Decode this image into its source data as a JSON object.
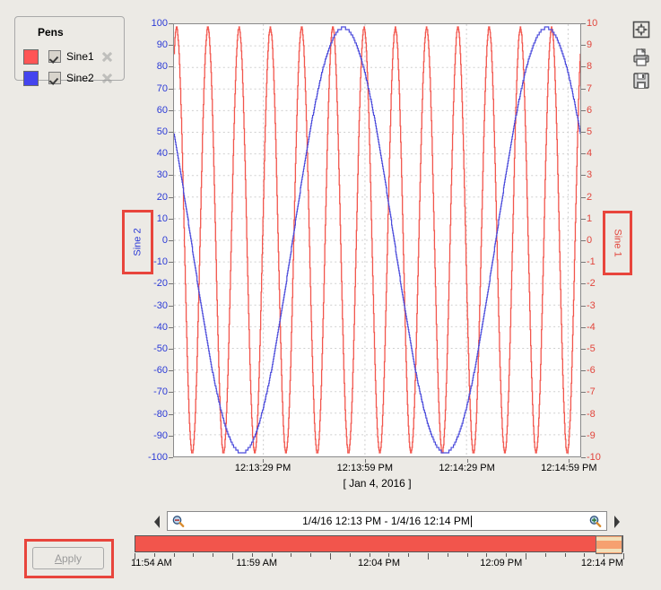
{
  "pens": {
    "title": "Pens",
    "items": [
      {
        "label": "Sine1",
        "color": "#FF5555",
        "checked": true,
        "remove_icon": "close-x-icon"
      },
      {
        "label": "Sine2",
        "color": "#4444EE",
        "checked": true,
        "remove_icon": "close-x-icon"
      }
    ]
  },
  "toolbar": {
    "fit_icon": "fit-to-window-icon",
    "print_icon": "printer-icon",
    "save_icon": "floppy-save-icon"
  },
  "axis_titles": {
    "left": "Sine 2",
    "right": "Sine 1",
    "highlight_color": "#E8453C"
  },
  "range_bar": {
    "left_arrow": "◀",
    "right_arrow": "▶",
    "value": "1/4/16 12:13 PM - 1/4/16 12:14 PM",
    "zoom_out_icon": "magnifier-minus-icon",
    "zoom_in_icon": "magnifier-plus-icon"
  },
  "timeline": {
    "labels": [
      "11:54 AM",
      "11:59 AM",
      "12:04 PM",
      "12:09 PM",
      "12:14 PM"
    ],
    "label_positions": [
      0,
      25,
      50,
      75,
      100
    ],
    "fill_color": "#F2554C",
    "handle_color": "#F6A070",
    "selection_start_pct": 94.5,
    "selection_end_pct": 100,
    "tick_count": 26
  },
  "apply": {
    "label_pre": "",
    "label_mnemonic": "A",
    "label_post": "pply",
    "enabled": false
  },
  "chart_data": {
    "type": "line",
    "title": "",
    "xlabel": "[ Jan 4, 2016 ]",
    "date_caption": "[ Jan 4, 2016 ]",
    "grid": true,
    "legend_position": "top-left",
    "x_tick_labels": [
      "12:13:29 PM",
      "12:13:59 PM",
      "12:14:29 PM",
      "12:14:59 PM"
    ],
    "x_tick_positions_pct": [
      22.0,
      47.0,
      72.0,
      97.0
    ],
    "x_range": [
      "12:13:12 PM",
      "12:15:01 PM"
    ],
    "y_left": {
      "name": "Sine 2",
      "color": "#2b3ad6",
      "min": -100,
      "max": 100,
      "step": 10,
      "ticks": [
        100,
        90,
        80,
        70,
        60,
        50,
        40,
        30,
        20,
        10,
        0,
        -10,
        -20,
        -30,
        -40,
        -50,
        -60,
        -70,
        -80,
        -90,
        -100
      ]
    },
    "y_right": {
      "name": "Sine 1",
      "color": "#e2453c",
      "min": -10,
      "max": 10,
      "step": 1,
      "ticks": [
        10,
        9,
        8,
        7,
        6,
        5,
        4,
        3,
        2,
        1,
        0,
        -1,
        -2,
        -3,
        -4,
        -5,
        -6,
        -7,
        -8,
        -9,
        -10
      ]
    },
    "series": [
      {
        "name": "Sine1",
        "color": "#F2554C",
        "axis": "right",
        "amplitude": 10,
        "cycles_visible": 13,
        "phase_deg": 62,
        "waveform": "sine",
        "stepped": true
      },
      {
        "name": "Sine2",
        "color": "#4A4ADB",
        "axis": "left",
        "amplitude": 100,
        "cycles_visible": 2,
        "phase_deg": 150,
        "waveform": "sine",
        "stepped": true
      }
    ]
  }
}
